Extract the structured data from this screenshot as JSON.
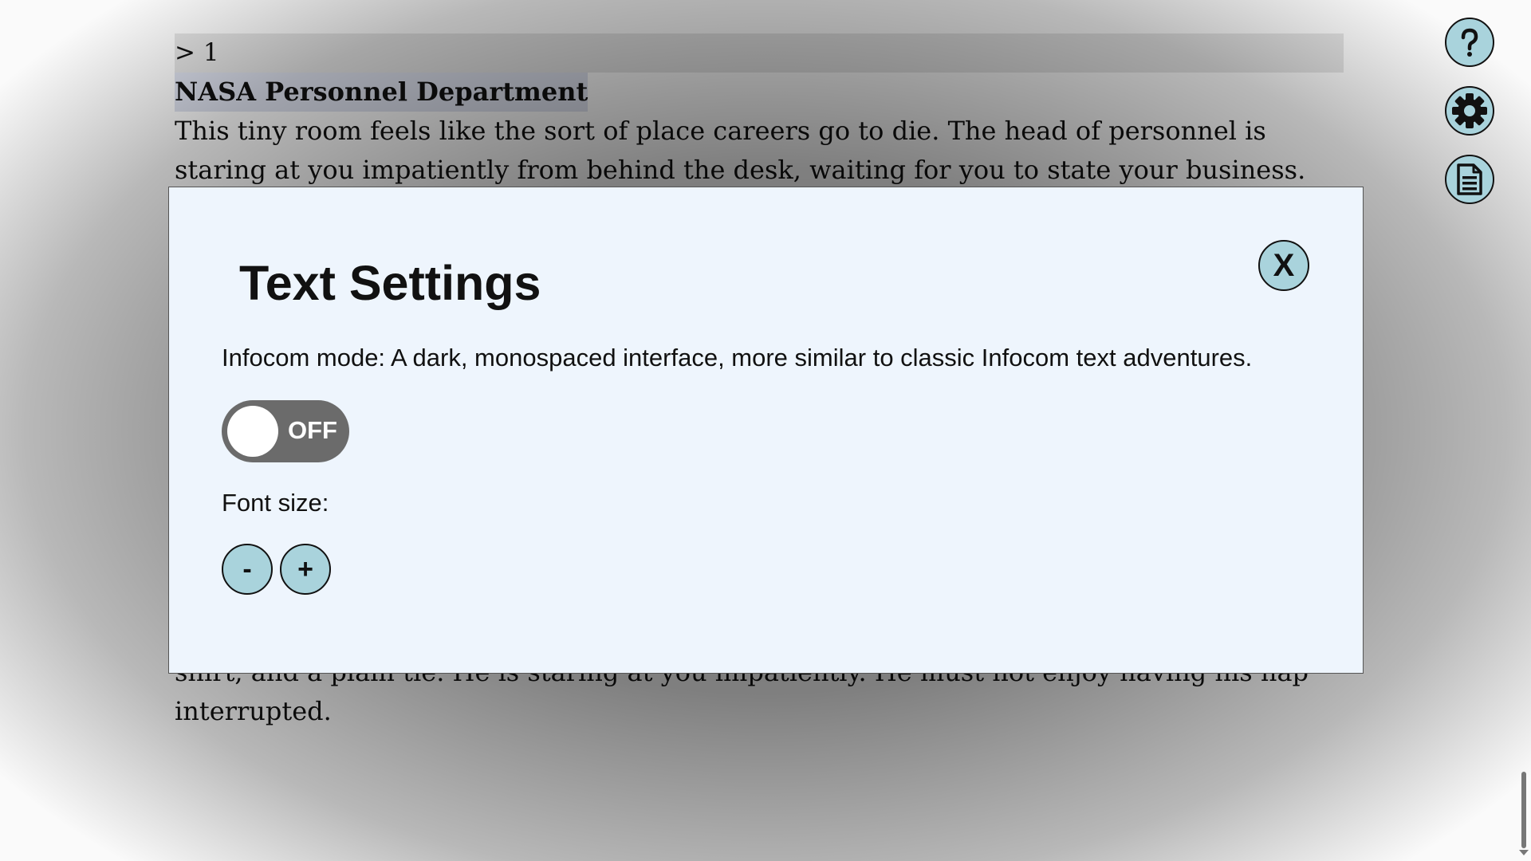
{
  "story": {
    "command": "> 1",
    "room_title": "NASA Personnel Department",
    "description": "This tiny room feels like the sort of place careers go to die.  The head of personnel is staring at you impatiently from behind the desk, waiting for you to state your business.",
    "tail_line1": "shirt, and a plain tie.  He is staring at you impatiently.  He must not enjoy having his nap",
    "tail_line2": "interrupted."
  },
  "side_buttons": {
    "help_icon": "question-mark-icon",
    "settings_icon": "gear-icon",
    "transcript_icon": "document-icon"
  },
  "dialog": {
    "title": "Text Settings",
    "close_label": "X",
    "infocom_description": "Infocom mode: A dark, monospaced interface, more similar to classic Infocom text adventures.",
    "toggle_state": "OFF",
    "font_size_label": "Font size:",
    "decrease_label": "-",
    "increase_label": "+"
  },
  "colors": {
    "button_fill": "#a9d3dc",
    "dialog_bg": "#eef5fd",
    "toggle_off": "#6b6b6b"
  }
}
